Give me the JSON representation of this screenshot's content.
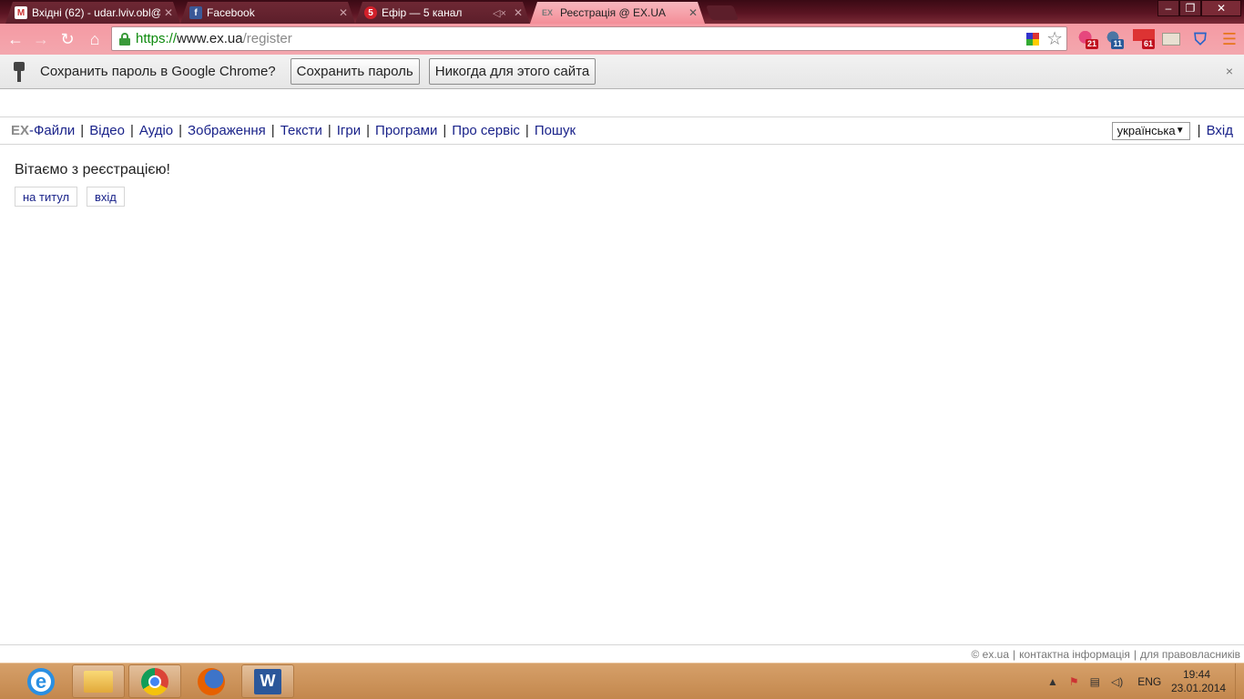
{
  "browser": {
    "tabs": [
      {
        "title": "Вхідні (62) - udar.lviv.obl@",
        "favicon": "gmail-icon",
        "active": false
      },
      {
        "title": "Facebook",
        "favicon": "facebook-icon",
        "active": false
      },
      {
        "title": "Ефір — 5 канал",
        "favicon": "channel5-icon",
        "active": false
      },
      {
        "title": "Реєстрація @ EX.UA",
        "favicon": "exua-icon",
        "active": true
      }
    ],
    "favicon_labels": {
      "gmail": "M",
      "facebook": "f",
      "channel5": "5",
      "exua": "EX"
    },
    "url": {
      "scheme": "https://",
      "host": "www.ex.ua",
      "path": "/register"
    },
    "extension_badges": {
      "ext1": "21",
      "ext2": "11",
      "ext3": "61"
    },
    "window_controls": {
      "minimize": "‒",
      "maximize": "❐",
      "close": "✕"
    }
  },
  "infobar": {
    "message": "Сохранить пароль в Google Chrome?",
    "save_button": "Сохранить пароль",
    "never_button": "Никогда для этого сайта",
    "close": "×"
  },
  "site": {
    "logo": "EX",
    "nav": [
      "-Файли",
      "Відео",
      "Аудіо",
      "Зображення",
      "Тексти",
      "Ігри",
      "Програми",
      "Про сервіс",
      "Пошук"
    ],
    "separator": "|",
    "language": "українська",
    "login": "Вхід",
    "welcome": "Вітаємо з реєстрацією!",
    "buttons": {
      "home": "на титул",
      "login": "вхід"
    },
    "footer": [
      "© ex.ua",
      "контактна інформація",
      "для правовласників"
    ]
  },
  "taskbar": {
    "word_label": "W",
    "ie_label": "e",
    "language": "ENG",
    "time": "19:44",
    "date": "23.01.2014"
  },
  "colors": {
    "toolbar": "#f59aa3",
    "link": "#1a238a",
    "url_scheme": "#0d8a0d"
  }
}
